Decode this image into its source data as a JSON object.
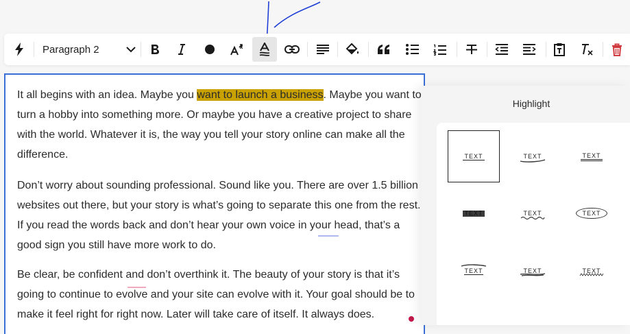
{
  "toolbar": {
    "block_style_value": "Paragraph 2",
    "buttons": [
      {
        "name": "quick-actions",
        "icon": "lightning-icon"
      },
      {
        "name": "bold",
        "icon": "bold-icon"
      },
      {
        "name": "italic",
        "icon": "italic-icon"
      },
      {
        "name": "text-color",
        "icon": "circle-icon"
      },
      {
        "name": "text-size",
        "icon": "text-size-icon"
      },
      {
        "name": "highlight",
        "icon": "highlight-icon",
        "active": true
      },
      {
        "name": "link",
        "icon": "link-icon"
      },
      {
        "name": "align",
        "icon": "align-left-icon"
      },
      {
        "name": "fill",
        "icon": "paint-bucket-icon"
      },
      {
        "name": "quote",
        "icon": "quote-icon"
      },
      {
        "name": "bullet-list",
        "icon": "bullet-list-icon"
      },
      {
        "name": "numbered-list",
        "icon": "numbered-list-icon"
      },
      {
        "name": "strikethrough",
        "icon": "strikethrough-icon"
      },
      {
        "name": "outdent",
        "icon": "outdent-icon"
      },
      {
        "name": "indent",
        "icon": "indent-icon"
      },
      {
        "name": "paste",
        "icon": "clipboard-icon"
      },
      {
        "name": "clear-format",
        "icon": "clear-format-icon"
      },
      {
        "name": "delete",
        "icon": "trash-icon"
      }
    ]
  },
  "editor": {
    "p1": {
      "before": "It all begins with an idea. Maybe you ",
      "highlighted": "want to launch a business",
      "after": ". Maybe you want to turn a hobby into something more. Or maybe you have a creative project to share with the world. Whatever it is, the way you tell your story online can make all the difference."
    },
    "p2": "Don’t worry about sounding professional. Sound like you. There are over 1.5 billion websites out there, but your story is what’s going to separate this one from the rest. If you read the words back and don’t hear your own voice in your head, that’s a good sign you still have more work to do.",
    "p3": "Be clear, be confident and don’t overthink it. The beauty of your story is that it’s going to continue to evolve and your site can evolve with it. Your goal should be to make it feel right for right now. Later will take care of itself. It always does."
  },
  "highlight_panel": {
    "title": "Highlight",
    "styles": [
      {
        "name": "plain",
        "label": "TEXT",
        "selected": true
      },
      {
        "name": "underline-swoosh",
        "label": "TEXT"
      },
      {
        "name": "double-underline",
        "label": "TEXT"
      },
      {
        "name": "marker-fill",
        "label": "TEXT"
      },
      {
        "name": "wavy-underline",
        "label": "TEXT"
      },
      {
        "name": "circled",
        "label": "TEXT"
      },
      {
        "name": "overline-swoosh",
        "label": "TEXT"
      },
      {
        "name": "scribble-underline",
        "label": "TEXT"
      },
      {
        "name": "zigzag-underline",
        "label": "TEXT"
      }
    ]
  },
  "colors": {
    "accent": "#3a6fd8",
    "highlight": "#c9a100",
    "annotation": "#1f3fd6",
    "delete": "#d0393e"
  }
}
